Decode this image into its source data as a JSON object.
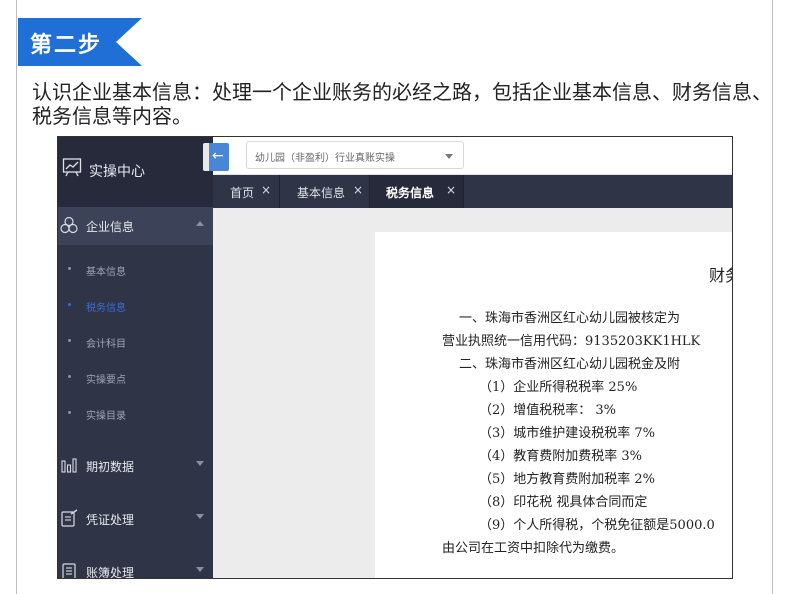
{
  "banner": {
    "step": "第二步",
    "color": "#1f6fd6"
  },
  "intro": "认识企业基本信息：处理一个企业账务的必经之路，包括企业基本信息、财务信息、税务信息等内容。",
  "app": {
    "sidebar": {
      "header": {
        "icon": "chart-board-icon",
        "label": "实操中心"
      },
      "sections": [
        {
          "id": "company",
          "icon": "cluster-icon",
          "label": "企业信息",
          "expanded": true
        },
        {
          "id": "opening",
          "icon": "bar-chart-icon",
          "label": "期初数据",
          "expanded": false
        },
        {
          "id": "voucher",
          "icon": "edit-doc-icon",
          "label": "凭证处理",
          "expanded": false
        },
        {
          "id": "ledger",
          "icon": "ledger-icon",
          "label": "账簿处理",
          "expanded": false
        }
      ],
      "company_items": [
        {
          "label": "基本信息",
          "active": false
        },
        {
          "label": "税务信息",
          "active": true
        },
        {
          "label": "会计科目",
          "active": false
        },
        {
          "label": "实操要点",
          "active": false
        },
        {
          "label": "实操目录",
          "active": false
        }
      ]
    },
    "topbar": {
      "course_select": "幼儿园（非盈利）行业真账实操",
      "collapse_icon": "arrow-left-icon"
    },
    "tabs": [
      {
        "label": "首页",
        "close": "×",
        "active": false
      },
      {
        "label": "基本信息",
        "close": "×",
        "active": false
      },
      {
        "label": "税务信息",
        "close": "×",
        "active": true
      }
    ],
    "document": {
      "title": "财务",
      "lines": [
        "一、珠海市香洲区红心幼儿园被核定为",
        "营业执照统一信用代码：9135203KK1HLK",
        "二、珠海市香洲区红心幼儿园税金及附",
        "（1）企业所得税税率      25%",
        "（2）增值税税率：          3%",
        "（3）城市维护建设税税率  7%",
        "（4）教育费附加费税率    3%",
        "（5）地方教育费附加税率  2%",
        "（8）印花税         视具体合同而定",
        "（9）个人所得税，个税免征额是5000.0",
        "由公司在工资中扣除代为缴费。"
      ]
    }
  }
}
